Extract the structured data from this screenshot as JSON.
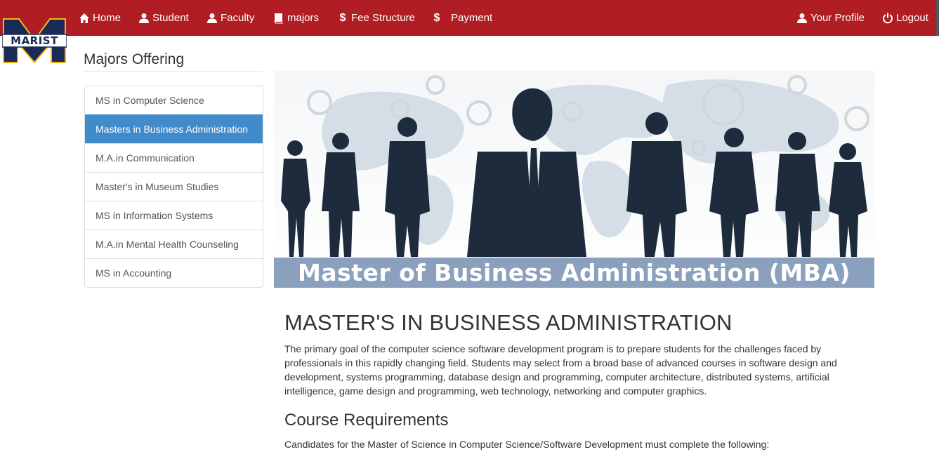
{
  "brand": {
    "logo_text": "MARIST",
    "logo_letter": "M"
  },
  "nav": {
    "left": [
      {
        "label": "Home",
        "icon": "home-icon"
      },
      {
        "label": "Student",
        "icon": "user-icon"
      },
      {
        "label": "Faculty",
        "icon": "user-icon"
      },
      {
        "label": "majors",
        "icon": "book-icon"
      },
      {
        "label": "Fee Structure",
        "icon": "dollar-icon"
      },
      {
        "label": "Payment",
        "icon": "dollar-icon"
      }
    ],
    "right": [
      {
        "label": "Your Profile",
        "icon": "user-icon"
      },
      {
        "label": "Logout",
        "icon": "power-icon"
      }
    ]
  },
  "sidebar": {
    "title": "Majors Offering",
    "items": [
      {
        "label": "MS in Computer Science"
      },
      {
        "label": "Masters in Business Administration",
        "active": true
      },
      {
        "label": "M.A.in Communication"
      },
      {
        "label": "Master's in Museum Studies"
      },
      {
        "label": "MS in Information Systems"
      },
      {
        "label": "M.A.in Mental Health Counseling"
      },
      {
        "label": "MS in Accounting"
      }
    ]
  },
  "banner": {
    "caption": "Master of Business Administration (MBA)"
  },
  "main": {
    "title": "MASTER'S IN BUSINESS ADMINISTRATION",
    "paragraph": "The primary goal of the computer science software development program is to prepare students for the challenges faced by professionals in this rapidly changing field. Students may select from a broad base of advanced courses in software design and development, systems programming, database design and programming, computer architecture, distributed systems, artificial intelligence, game design and programming, web technology, networking and computer graphics.",
    "subtitle": "Course Requirements",
    "subparagraph": "Candidates for the Master of Science in Computer Science/Software Development must complete the following:"
  },
  "colors": {
    "navbar": "#b01e23",
    "active_item": "#428bca",
    "banner_caption_bg": "#8aa0bd",
    "logo_navy": "#1b2a57",
    "logo_gold": "#f2b80f"
  }
}
